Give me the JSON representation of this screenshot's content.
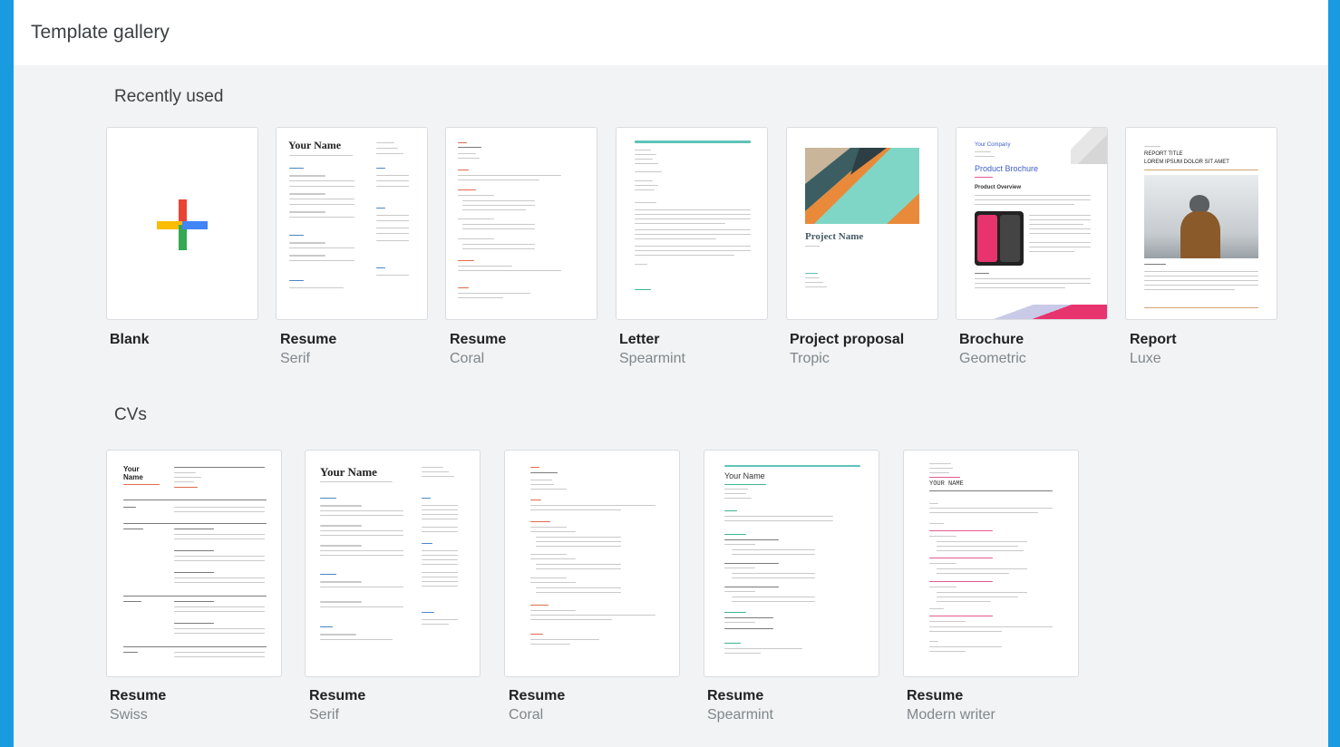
{
  "header": {
    "title": "Template gallery"
  },
  "sections": [
    {
      "title": "Recently used",
      "templates": [
        {
          "name": "Blank",
          "style": ""
        },
        {
          "name": "Resume",
          "style": "Serif"
        },
        {
          "name": "Resume",
          "style": "Coral"
        },
        {
          "name": "Letter",
          "style": "Spearmint"
        },
        {
          "name": "Project proposal",
          "style": "Tropic"
        },
        {
          "name": "Brochure",
          "style": "Geometric"
        },
        {
          "name": "Report",
          "style": "Luxe"
        }
      ]
    },
    {
      "title": "CVs",
      "templates": [
        {
          "name": "Resume",
          "style": "Swiss"
        },
        {
          "name": "Resume",
          "style": "Serif"
        },
        {
          "name": "Resume",
          "style": "Coral"
        },
        {
          "name": "Resume",
          "style": "Spearmint"
        },
        {
          "name": "Resume",
          "style": "Modern writer"
        }
      ]
    }
  ],
  "thumbs": {
    "your_name": "Your Name",
    "your_name_upper": "YOUR NAME",
    "your_name_split_1": "Your",
    "your_name_split_2": "Name",
    "project_name": "Project Name",
    "product_brochure": "Product Brochure",
    "product_overview": "Product Overview",
    "your_company": "Your Company",
    "report_title": "REPORT TITLE",
    "report_subtitle": "LOREM IPSUM DOLOR SIT AMET"
  },
  "colors": {
    "google_blue": "#4285f4",
    "google_red": "#ea4335",
    "google_yellow": "#fbbc04",
    "google_green": "#34a853"
  }
}
